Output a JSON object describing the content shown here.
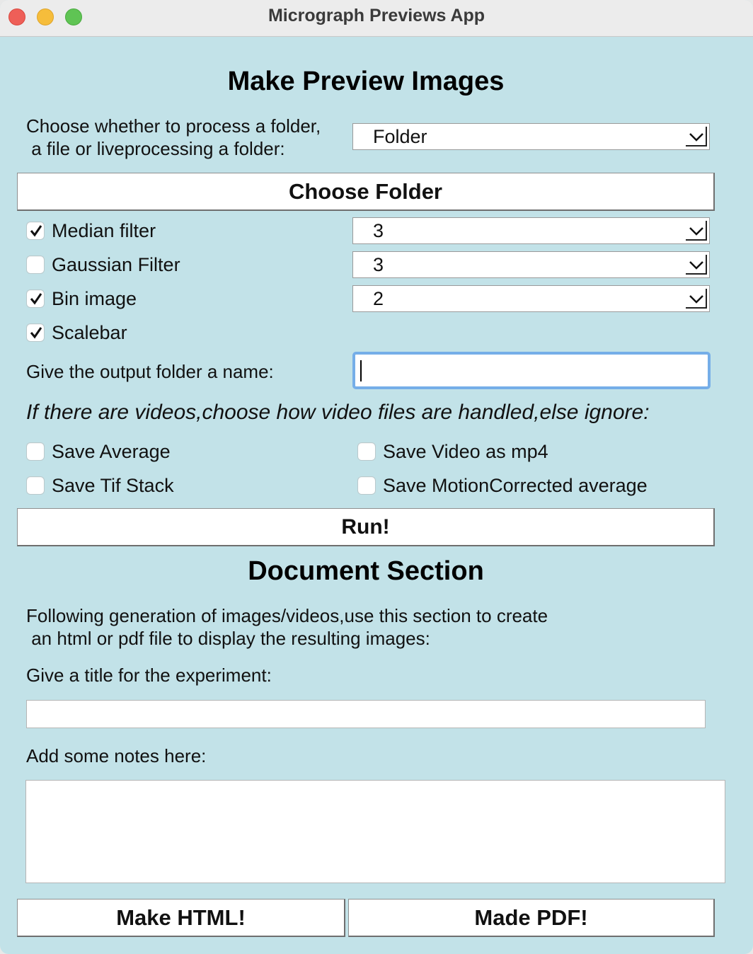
{
  "window": {
    "title": "Micrograph Previews App"
  },
  "main": {
    "heading": "Make Preview Images",
    "mode_prompt_line1": "Choose whether to process a folder,",
    "mode_prompt_line2": " a file or liveprocessing a folder:",
    "mode_select_value": "Folder",
    "choose_button": "Choose Folder",
    "filters": [
      {
        "label": "Median filter",
        "checked": true,
        "value": "3"
      },
      {
        "label": "Gaussian Filter",
        "checked": false,
        "value": "3"
      },
      {
        "label": "Bin image",
        "checked": true,
        "value": "2"
      }
    ],
    "scalebar": {
      "label": "Scalebar",
      "checked": true
    },
    "output_label": "Give the output folder a name:",
    "output_value": "",
    "video_prompt": "If there are videos,choose how video files are handled,else ignore:",
    "video_options": [
      {
        "label": "Save Average",
        "checked": false
      },
      {
        "label": "Save Video as mp4",
        "checked": false
      },
      {
        "label": "Save Tif Stack",
        "checked": false
      },
      {
        "label": "Save MotionCorrected average",
        "checked": false
      }
    ],
    "run_button": "Run!"
  },
  "document": {
    "heading": "Document Section",
    "intro_line1": "Following generation of images/videos,use this section to create",
    "intro_line2": " an html or pdf file to display the resulting images:",
    "title_label": "Give a title for the experiment:",
    "title_value": "",
    "notes_label": "Add some notes here:",
    "notes_value": "",
    "html_button": "Make HTML!",
    "pdf_button": "Made PDF!"
  }
}
